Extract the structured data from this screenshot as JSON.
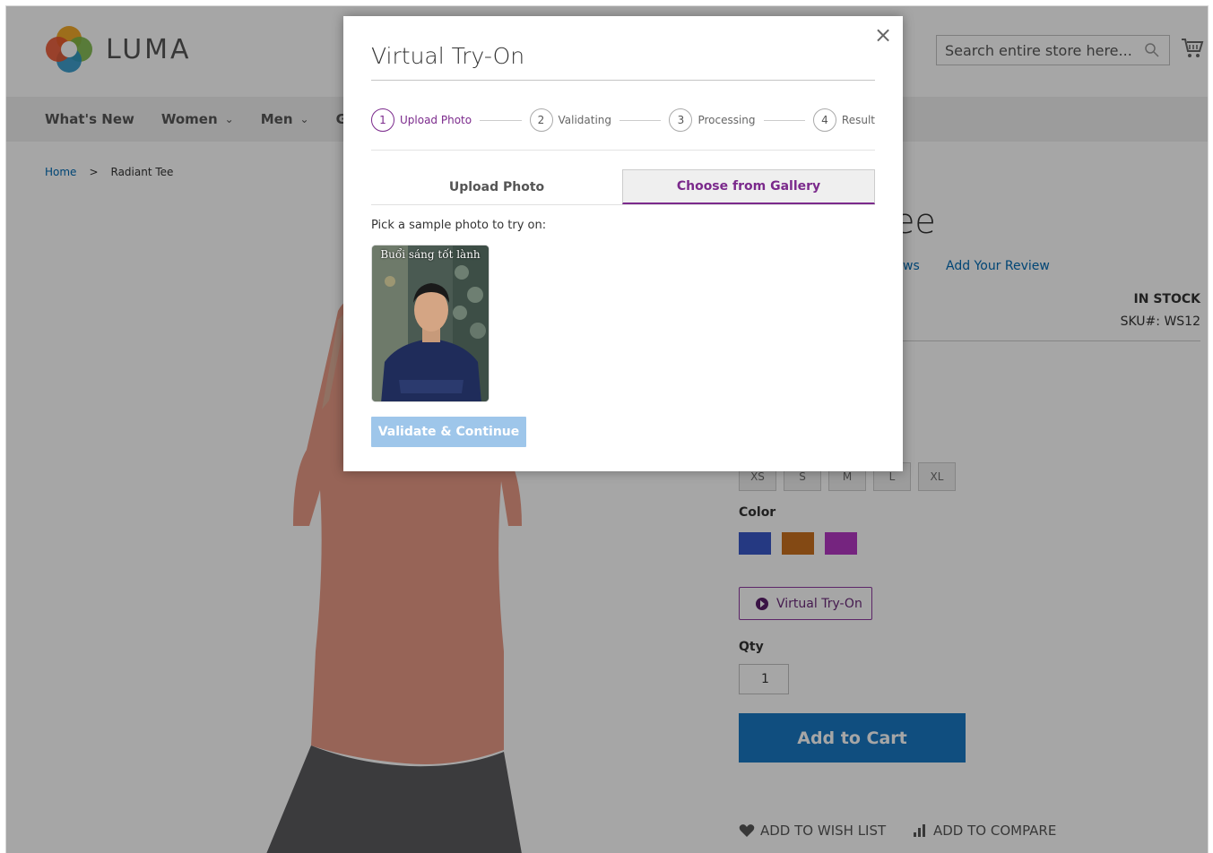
{
  "brand": {
    "name": "LUMA"
  },
  "search": {
    "placeholder": "Search entire store here..."
  },
  "nav": {
    "items": [
      {
        "label": "What's New",
        "has_dropdown": false
      },
      {
        "label": "Women",
        "has_dropdown": true
      },
      {
        "label": "Men",
        "has_dropdown": true
      },
      {
        "label": "Gear",
        "has_dropdown": false
      }
    ]
  },
  "breadcrumb": {
    "home": "Home",
    "separator": ">",
    "current": "Radiant Tee"
  },
  "product": {
    "title_fragment": "ee",
    "reviews_fragment": "ws",
    "add_review": "Add Your Review",
    "stock": "IN STOCK",
    "sku": "SKU#:  WS12",
    "sizes": [
      "XS",
      "S",
      "M",
      "L",
      "XL"
    ],
    "color_label": "Color",
    "colors": [
      "#3a58c8",
      "#c9711f",
      "#b438c4"
    ],
    "virtual_tryon_label": "Virtual Try-On",
    "qty_label": "Qty",
    "qty_value": "1",
    "add_to_cart": "Add to Cart",
    "wish_list": "Add to Wish List",
    "compare": "Add to Compare"
  },
  "modal": {
    "title": "Virtual Try-On",
    "close_symbol": "×",
    "steps": [
      {
        "num": "1",
        "label": "Upload Photo",
        "active": true
      },
      {
        "num": "2",
        "label": "Validating",
        "active": false
      },
      {
        "num": "3",
        "label": "Processing",
        "active": false
      },
      {
        "num": "4",
        "label": "Result",
        "active": false
      }
    ],
    "tabs": [
      {
        "label": "Upload Photo",
        "active": false
      },
      {
        "label": "Choose from Gallery",
        "active": true
      }
    ],
    "pick_label": "Pick a sample photo to try on:",
    "sample_caption": "Buổi sáng tốt lành",
    "validate_button": "Validate & Continue"
  },
  "colors": {
    "accent_purple": "#7b2a8c",
    "link_blue": "#006bb4",
    "cart_blue": "#1979c3",
    "validate_disabled": "#9ec6ea"
  }
}
